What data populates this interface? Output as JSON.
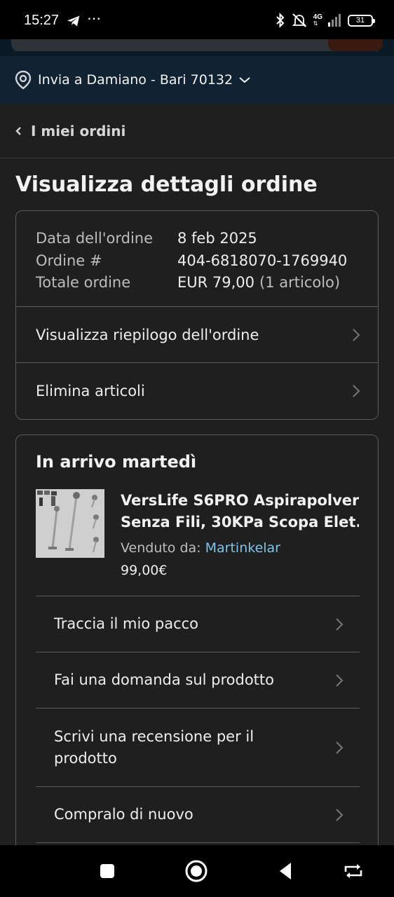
{
  "status_bar": {
    "time": "15:27",
    "dots": "⋯",
    "network": "4G",
    "battery": "31"
  },
  "deliver": {
    "text": "Invia a Damiano - Bari 70132"
  },
  "back_nav": {
    "label": "I miei ordini"
  },
  "page_title": "Visualizza dettagli ordine",
  "order_info": {
    "date_label": "Data dell'ordine",
    "date_value": "8 feb 2025",
    "number_label": "Ordine #",
    "number_value": "404-6818070-1769940",
    "total_label": "Totale ordine",
    "total_value": "EUR 79,00",
    "total_extra": "(1 articolo)"
  },
  "order_links": {
    "summary": "Visualizza riepilogo dell'ordine",
    "remove": "Elimina articoli"
  },
  "shipment": {
    "title": "In arrivo martedì",
    "product_title_line1": "VersLife S6PRO Aspirapolvere",
    "product_title_line2": "Senza Fili, 30KPa Scopa Elet...",
    "sold_by_label": "Venduto da:",
    "seller": "Martinkelar",
    "price": "99,00€",
    "actions": {
      "track": "Traccia il mio pacco",
      "ask": "Fai una domanda sul prodotto",
      "review_line1": "Scrivi una recensione per il",
      "review_line2": "prodotto",
      "buy_again": "Compralo di nuovo"
    }
  },
  "colors": {
    "background": "#1f1f1f",
    "header": "#112233",
    "seller_link": "#7cc4e8",
    "border": "#5a5a5a"
  },
  "icons": {
    "location": "location-pin-icon",
    "chevron_down": "chevron-down-icon",
    "back": "chevron-left-icon",
    "row_chevron": "chevron-right-icon"
  }
}
